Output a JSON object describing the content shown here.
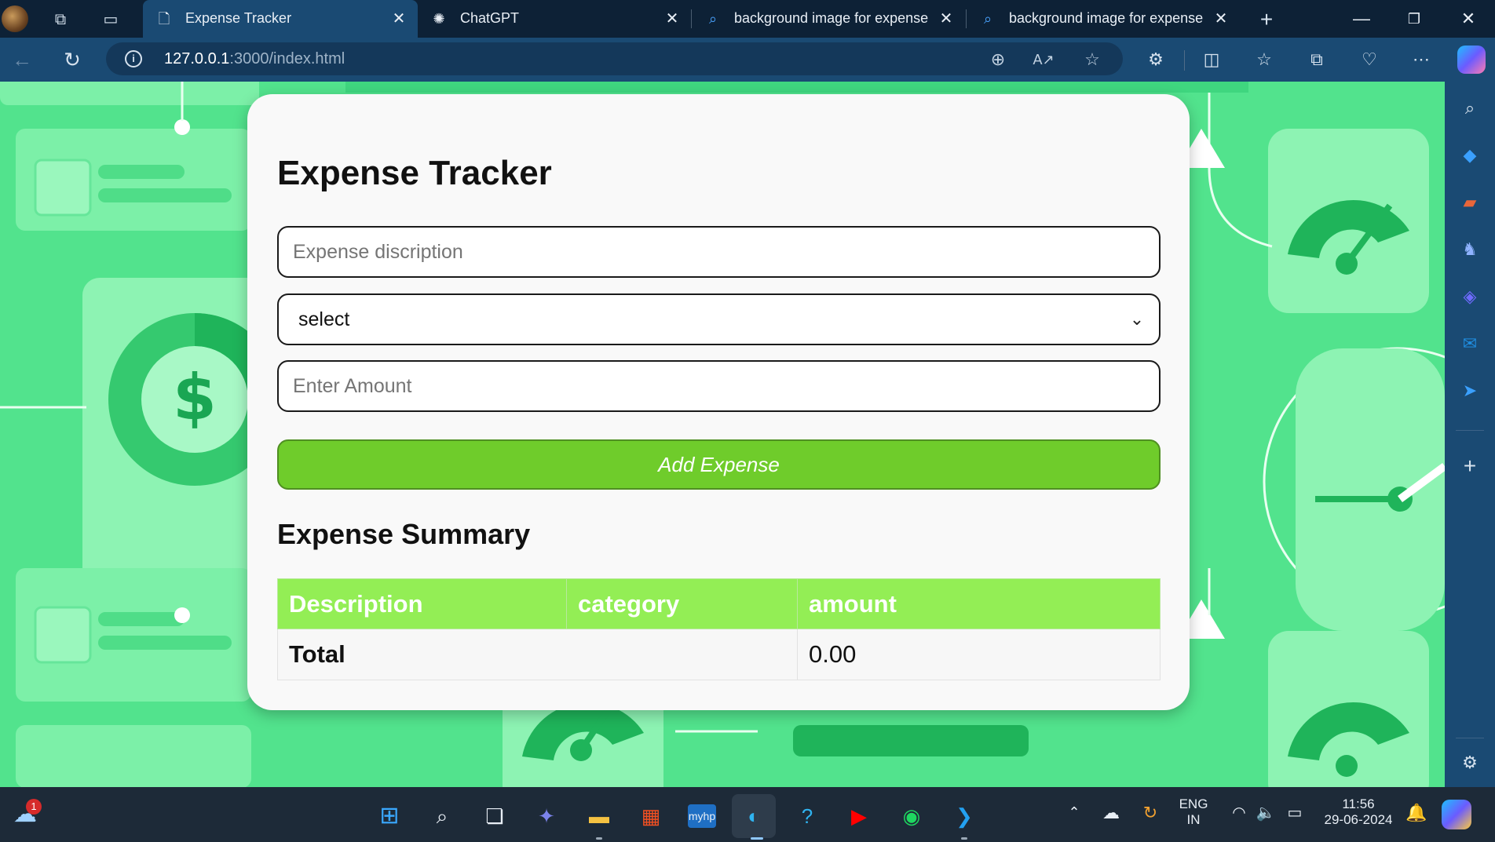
{
  "browser": {
    "tabs": [
      {
        "title": "Expense Tracker",
        "icon": "page-icon",
        "active": true
      },
      {
        "title": "ChatGPT",
        "icon": "chatgpt-icon",
        "active": false
      },
      {
        "title": "background image for expense",
        "icon": "search-icon",
        "active": false
      },
      {
        "title": "background image for expense",
        "icon": "search-icon",
        "active": false
      }
    ],
    "url_host": "127.0.0.1",
    "url_path": ":3000/index.html"
  },
  "app": {
    "title": "Expense Tracker",
    "description_placeholder": "Expense discription",
    "category_selected": "select",
    "amount_placeholder": "Enter Amount",
    "add_button": "Add Expense",
    "summary_title": "Expense Summary",
    "table": {
      "headers": [
        "Description",
        "category",
        "amount"
      ],
      "total_label": "Total",
      "total_value": "0.00"
    }
  },
  "taskbar": {
    "weather_badge": "1",
    "language": "ENG",
    "region": "IN",
    "time": "11:56",
    "date": "29-06-2024"
  },
  "colors": {
    "page_background": "#52e38d",
    "header_green": "#93ee55",
    "button_green": "#6fcc2b",
    "browser_frame": "#1a4a73"
  }
}
